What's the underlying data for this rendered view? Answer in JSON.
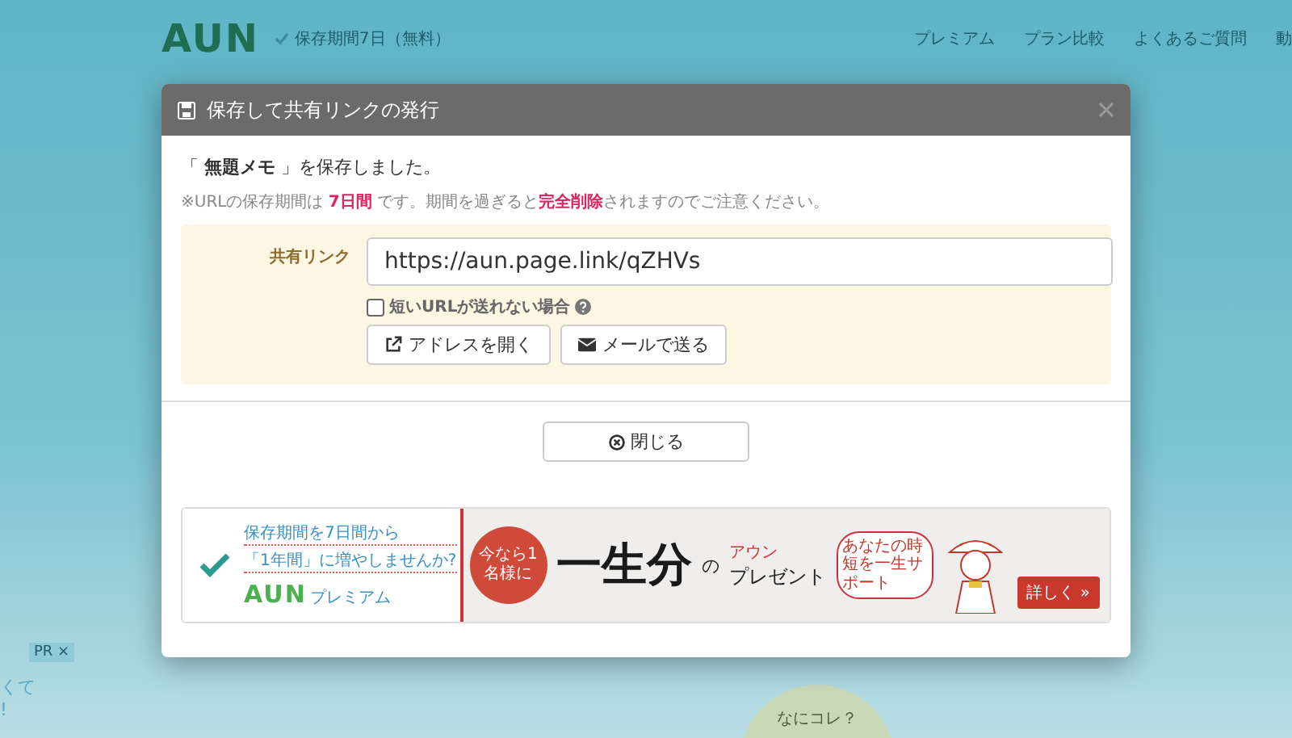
{
  "page": {
    "logo": "AUN",
    "plan_badge": "保存期間7日（無料）",
    "nav": [
      "プレミアム",
      "プラン比較",
      "よくあるご質問",
      "動"
    ],
    "pr_label": "PR ×",
    "side_text": [
      "くて",
      "!"
    ],
    "help_bubble": "なにコレ？"
  },
  "dialog": {
    "title": "保存して共有リンクの発行",
    "saved_message": "「 **無題メモ** 」を保存しました。",
    "notice": "※URLの保存期間は **7日間** です。期間を過ぎると**完全削除**されますのでご注意ください。",
    "share_link": {
      "label": "共有リンク",
      "value": "https://aun.page.link/qZHVs"
    },
    "short_url_checkbox": {
      "label": "短いURLが送れない場合",
      "checked": false
    },
    "buttons": [
      {
        "kind": "open",
        "label": "アドレスを開く"
      },
      {
        "kind": "mail",
        "label": "メールで送る"
      }
    ],
    "close_button": "閉じる",
    "banner": {
      "headline_lines": [
        "保存期間を7日間から",
        "「1年間」に増やしませんか?"
      ],
      "logo": "AUN",
      "logo_suffix": "プレミアム",
      "badge": "今なら1名様に",
      "title_main": "一生分",
      "title_particle": "の",
      "title_kana": "アウン",
      "title_sub": "プレゼント",
      "bubble": "あなたの時短を一生サポート",
      "more_button": "詳しく »"
    }
  }
}
